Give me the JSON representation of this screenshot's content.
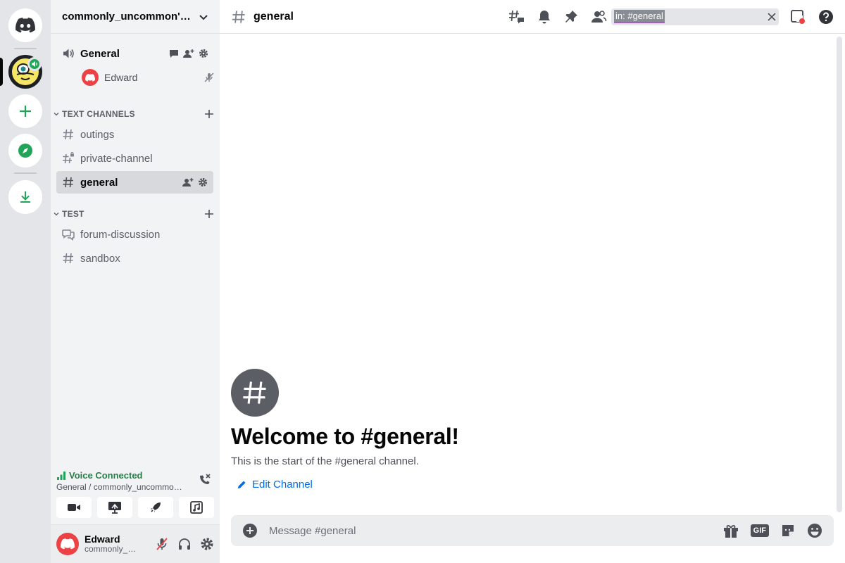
{
  "server": {
    "name": "commonly_uncommon's ..."
  },
  "voice_channel": {
    "name": "General",
    "user": "Edward"
  },
  "categories": [
    {
      "label": "TEXT CHANNELS"
    },
    {
      "label": "TEST"
    }
  ],
  "channels": {
    "outings": "outings",
    "private": "private-channel",
    "general": "general",
    "forum": "forum-discussion",
    "sandbox": "sandbox"
  },
  "voice_panel": {
    "status": "Voice Connected",
    "sub": "General / commonly_uncommon's server"
  },
  "user_panel": {
    "name": "Edward",
    "tag": "commonly_uncommon"
  },
  "topbar": {
    "channel": "general",
    "search_value": "in: #general"
  },
  "welcome": {
    "title": "Welcome to #general!",
    "subtitle": "This is the start of the #general channel.",
    "edit_label": "Edit Channel"
  },
  "composer": {
    "placeholder": "Message #general",
    "gif_label": "GIF"
  },
  "colors": {
    "accent_green": "#23a559",
    "link_blue": "#006ce7",
    "brand": "#5865f2",
    "danger": "#ed4245"
  }
}
